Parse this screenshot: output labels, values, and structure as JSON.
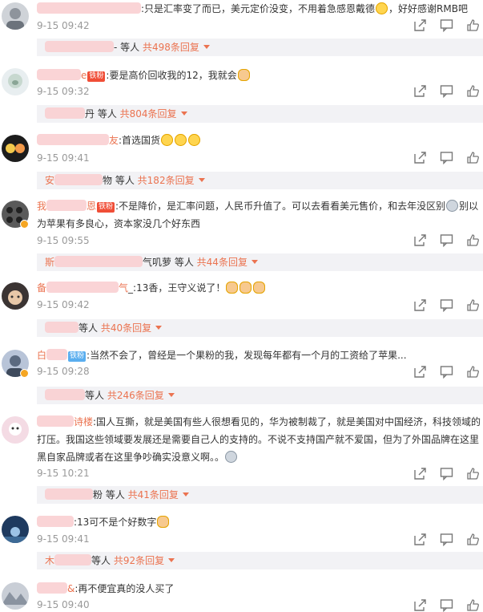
{
  "comments": [
    {
      "text_a": ":只是汇率变了而已，美元定价没变，不用着急感恩戴德",
      "text_b": "，好好感谢RMB吧",
      "time": "9-15 09:42",
      "reply_tail": "- 等人",
      "reply_count": "共498条回复"
    },
    {
      "name_tail": "e",
      "badge": "铁粉",
      "text": ":要是高价回收我的12，我就会",
      "time": "9-15 09:32",
      "reply_tail": "丹 等人",
      "reply_count": "共804条回复"
    },
    {
      "name_tail": "友",
      "text": ":首选国货",
      "time": "9-15 09:41",
      "reply_head": "安",
      "reply_tail": "物 等人",
      "reply_count": "共182条回复"
    },
    {
      "name_head": "我",
      "name_tail": "恩",
      "badge": "铁粉",
      "text_a": ":不是降价，是汇率问题，人民币升值了。可以去看看美元售价，和去年没区别",
      "text_b": "别以为苹果有多良心，资本家没几个好东西",
      "time": "9-15 09:55",
      "reply_head": "斯",
      "reply_tail": "气叽萝 等人",
      "reply_count": "共44条回复"
    },
    {
      "name_head": "备",
      "name_tail": "气",
      "text": "_:13香，王守义说了！",
      "time": "9-15 09:42",
      "reply_tail": "等人",
      "reply_count": "共40条回复"
    },
    {
      "name_head": "白",
      "badge": "铁粉",
      "text": ":当然不会了，曾经是一个果粉的我，发现每年都有一个月的工资给了苹果...",
      "time": "9-15 09:28",
      "reply_tail": "等人",
      "reply_count": "共246条回复"
    },
    {
      "name_tail": "诗楼",
      "text": ":国人互撕，就是美国有些人很想看见的，华为被制裁了，就是美国对中国经济，科技领域的打压。我国这些领域要发展还是需要自己人的支持的。不说不支持国产就不爱国，但为了外国品牌在这里黑自家品牌或者在这里争吵确实没意义啊。。",
      "time": "9-15 10:21",
      "reply_tail": "粉 等人",
      "reply_count": "共41条回复"
    },
    {
      "text": ":13可不是个好数字",
      "time": "9-15 09:41",
      "reply_head": "木",
      "reply_tail": "等人",
      "reply_count": "共92条回复"
    },
    {
      "name_tail": "&",
      "text": ":再不便宜真的没人买了",
      "time": "9-15 09:40"
    }
  ],
  "icons": {
    "forward": "share-icon",
    "comment": "comment-icon",
    "like": "thumbs-up-icon"
  },
  "colors": {
    "link": "#eb7350",
    "reply_bg": "#f2f2f5",
    "time": "#999999"
  }
}
